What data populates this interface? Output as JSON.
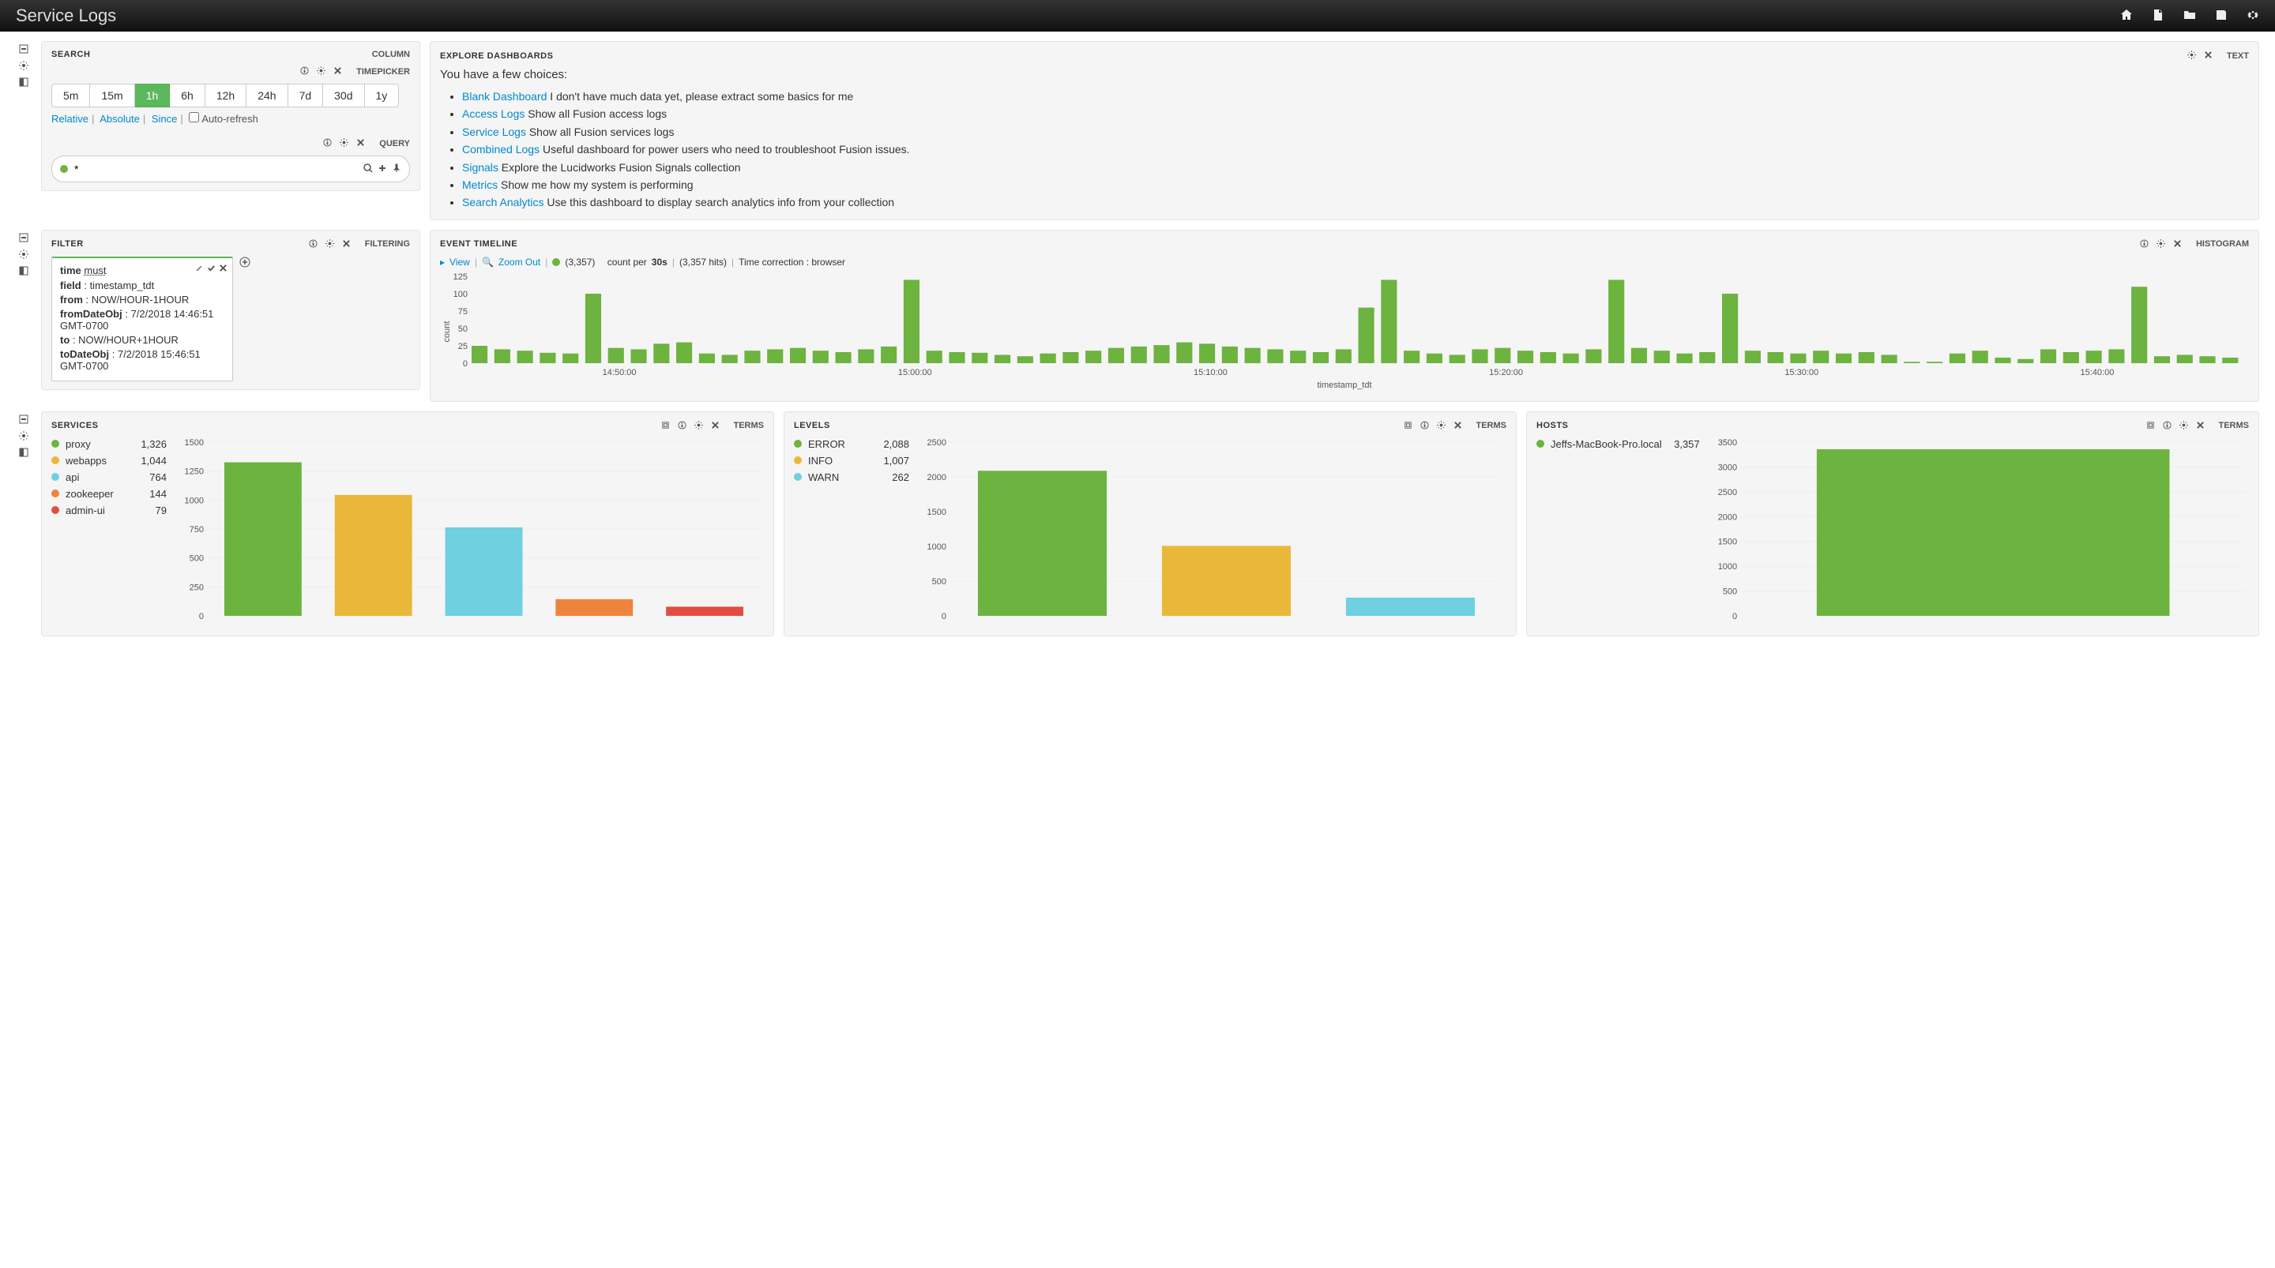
{
  "topbar": {
    "title": "Service Logs"
  },
  "search": {
    "title": "SEARCH",
    "tag": "COLUMN",
    "timepicker": {
      "tag": "TIMEPICKER",
      "buttons": [
        "5m",
        "15m",
        "1h",
        "6h",
        "12h",
        "24h",
        "7d",
        "30d",
        "1y"
      ],
      "active": "1h",
      "link_relative": "Relative",
      "link_absolute": "Absolute",
      "link_since": "Since",
      "autorefresh": "Auto-refresh"
    },
    "query": {
      "tag": "QUERY",
      "value": "*"
    }
  },
  "explore": {
    "title": "EXPLORE DASHBOARDS",
    "tag": "TEXT",
    "intro": "You have a few choices:",
    "items": [
      {
        "link": "Blank Dashboard",
        "text": " I don't have much data yet, please extract some basics for me"
      },
      {
        "link": "Access Logs",
        "text": " Show all Fusion access logs"
      },
      {
        "link": "Service Logs",
        "text": " Show all Fusion services logs"
      },
      {
        "link": "Combined Logs",
        "text": " Useful dashboard for power users who need to troubleshoot Fusion issues."
      },
      {
        "link": "Signals",
        "text": " Explore the Lucidworks Fusion Signals collection"
      },
      {
        "link": "Metrics",
        "text": " Show me how my system is performing"
      },
      {
        "link": "Search Analytics",
        "text": " Use this dashboard to display search analytics info from your collection"
      }
    ]
  },
  "filter": {
    "title": "FILTER",
    "tag": "FILTERING",
    "card": {
      "label_k": "time",
      "label_v": "must",
      "rows": [
        {
          "k": "field",
          "v": "timestamp_tdt"
        },
        {
          "k": "from",
          "v": "NOW/HOUR-1HOUR"
        },
        {
          "k": "fromDateObj",
          "v": "7/2/2018 14:46:51 GMT-0700"
        },
        {
          "k": "to",
          "v": "NOW/HOUR+1HOUR"
        },
        {
          "k": "toDateObj",
          "v": "7/2/2018 15:46:51 GMT-0700"
        }
      ]
    }
  },
  "timeline": {
    "title": "EVENT TIMELINE",
    "tag": "HISTOGRAM",
    "view": "View",
    "zoom": "Zoom Out",
    "count_str": "(3,357)",
    "per": "count per",
    "interval": "30s",
    "hits": "(3,357 hits)",
    "tz": "Time correction : browser",
    "xlabel": "timestamp_tdt",
    "ylabel": "count"
  },
  "services": {
    "title": "SERVICES",
    "tag": "TERMS",
    "items": [
      {
        "name": "proxy",
        "value": 1326,
        "color": "#6db33f"
      },
      {
        "name": "webapps",
        "value": 1044,
        "color": "#eab839"
      },
      {
        "name": "api",
        "value": 764,
        "color": "#6ed0e0"
      },
      {
        "name": "zookeeper",
        "value": 144,
        "color": "#ef843c"
      },
      {
        "name": "admin-ui",
        "value": 79,
        "color": "#e24d42"
      }
    ]
  },
  "levels": {
    "title": "LEVELS",
    "tag": "TERMS",
    "items": [
      {
        "name": "ERROR",
        "value": 2088,
        "color": "#6db33f"
      },
      {
        "name": "INFO",
        "value": 1007,
        "color": "#eab839"
      },
      {
        "name": "WARN",
        "value": 262,
        "color": "#6ed0e0"
      }
    ]
  },
  "hosts": {
    "title": "HOSTS",
    "tag": "TERMS",
    "items": [
      {
        "name": "Jeffs-MacBook-Pro.local",
        "value": 3357,
        "color": "#6db33f"
      }
    ]
  },
  "chart_data": [
    {
      "type": "bar",
      "title": "EVENT TIMELINE",
      "xlabel": "timestamp_tdt",
      "ylabel": "count",
      "ylim": [
        0,
        125
      ],
      "x_ticks": [
        "14:50:00",
        "15:00:00",
        "15:10:00",
        "15:20:00",
        "15:30:00",
        "15:40:00"
      ],
      "values": [
        25,
        20,
        18,
        15,
        14,
        100,
        22,
        20,
        28,
        30,
        14,
        12,
        18,
        20,
        22,
        18,
        16,
        20,
        24,
        120,
        18,
        16,
        15,
        12,
        10,
        14,
        16,
        18,
        22,
        24,
        26,
        30,
        28,
        24,
        22,
        20,
        18,
        16,
        20,
        80,
        120,
        18,
        14,
        12,
        20,
        22,
        18,
        16,
        14,
        20,
        120,
        22,
        18,
        14,
        16,
        100,
        18,
        16,
        14,
        18,
        14,
        16,
        12,
        2,
        2,
        14,
        18,
        8,
        6,
        20,
        16,
        18,
        20,
        110,
        10,
        12,
        10,
        8
      ],
      "color": "#6db33f",
      "note": "values estimated from pixel heights; total ≈ 3357"
    },
    {
      "type": "bar",
      "title": "SERVICES",
      "ylim": [
        0,
        1500
      ],
      "categories": [
        "proxy",
        "webapps",
        "api",
        "zookeeper",
        "admin-ui"
      ],
      "values": [
        1326,
        1044,
        764,
        144,
        79
      ],
      "colors": [
        "#6db33f",
        "#eab839",
        "#6ed0e0",
        "#ef843c",
        "#e24d42"
      ]
    },
    {
      "type": "bar",
      "title": "LEVELS",
      "ylim": [
        0,
        2500
      ],
      "categories": [
        "ERROR",
        "INFO",
        "WARN"
      ],
      "values": [
        2088,
        1007,
        262
      ],
      "colors": [
        "#6db33f",
        "#eab839",
        "#6ed0e0"
      ]
    },
    {
      "type": "bar",
      "title": "HOSTS",
      "ylim": [
        0,
        3500
      ],
      "categories": [
        "Jeffs-MacBook-Pro.local"
      ],
      "values": [
        3357
      ],
      "colors": [
        "#6db33f"
      ]
    }
  ]
}
